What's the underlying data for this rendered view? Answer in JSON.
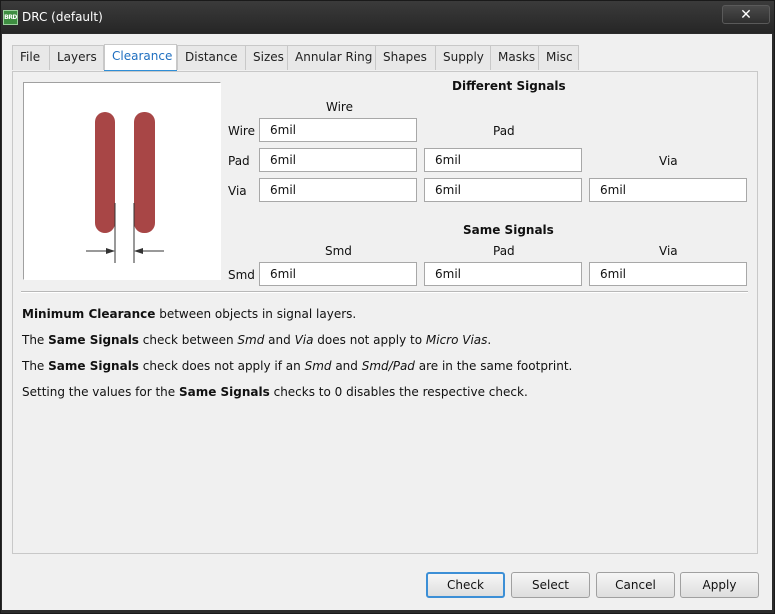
{
  "window": {
    "title": "DRC (default)",
    "icon_text": "BRD",
    "close_glyph": "✕"
  },
  "tabs": [
    {
      "label": "File"
    },
    {
      "label": "Layers"
    },
    {
      "label": "Clearance",
      "active": true
    },
    {
      "label": "Distance"
    },
    {
      "label": "Sizes"
    },
    {
      "label": "Annular Ring"
    },
    {
      "label": "Shapes"
    },
    {
      "label": "Supply"
    },
    {
      "label": "Masks"
    },
    {
      "label": "Misc"
    }
  ],
  "different_signals": {
    "heading": "Different Signals",
    "col_wire": "Wire",
    "col_pad": "Pad",
    "col_via": "Via",
    "row_wire": "Wire",
    "row_pad": "Pad",
    "row_via": "Via",
    "wire_wire": "6mil",
    "pad_wire": "6mil",
    "pad_pad": "6mil",
    "via_wire": "6mil",
    "via_pad": "6mil",
    "via_via": "6mil"
  },
  "same_signals": {
    "heading": "Same Signals",
    "col_smd": "Smd",
    "col_pad": "Pad",
    "col_via": "Via",
    "row_smd": "Smd",
    "smd_smd": "6mil",
    "smd_pad": "6mil",
    "smd_via": "6mil"
  },
  "help": {
    "l1_b": "Minimum Clearance",
    "l1_t": " between objects in signal layers.",
    "l2_a": "The ",
    "l2_b": "Same Signals",
    "l2_c": " check between ",
    "l2_i1": "Smd",
    "l2_d": " and ",
    "l2_i2": "Via",
    "l2_e": " does not apply to ",
    "l2_i3": "Micro Vias",
    "l2_f": ".",
    "l3_a": "The ",
    "l3_b": "Same Signals",
    "l3_c": " check does not apply if an ",
    "l3_i1": "Smd",
    "l3_d": " and ",
    "l3_i2": "Smd/Pad",
    "l3_e": " are in the same footprint.",
    "l4_a": "Setting the values for the ",
    "l4_b": "Same Signals",
    "l4_c": " checks to 0 disables the respective check."
  },
  "buttons": {
    "check": "Check",
    "select": "Select",
    "cancel": "Cancel",
    "apply": "Apply"
  },
  "colors": {
    "trace": "#a84646",
    "accent": "#2f8ed6"
  },
  "icons": [
    "app-icon",
    "close-icon",
    "clearance-diagram"
  ]
}
